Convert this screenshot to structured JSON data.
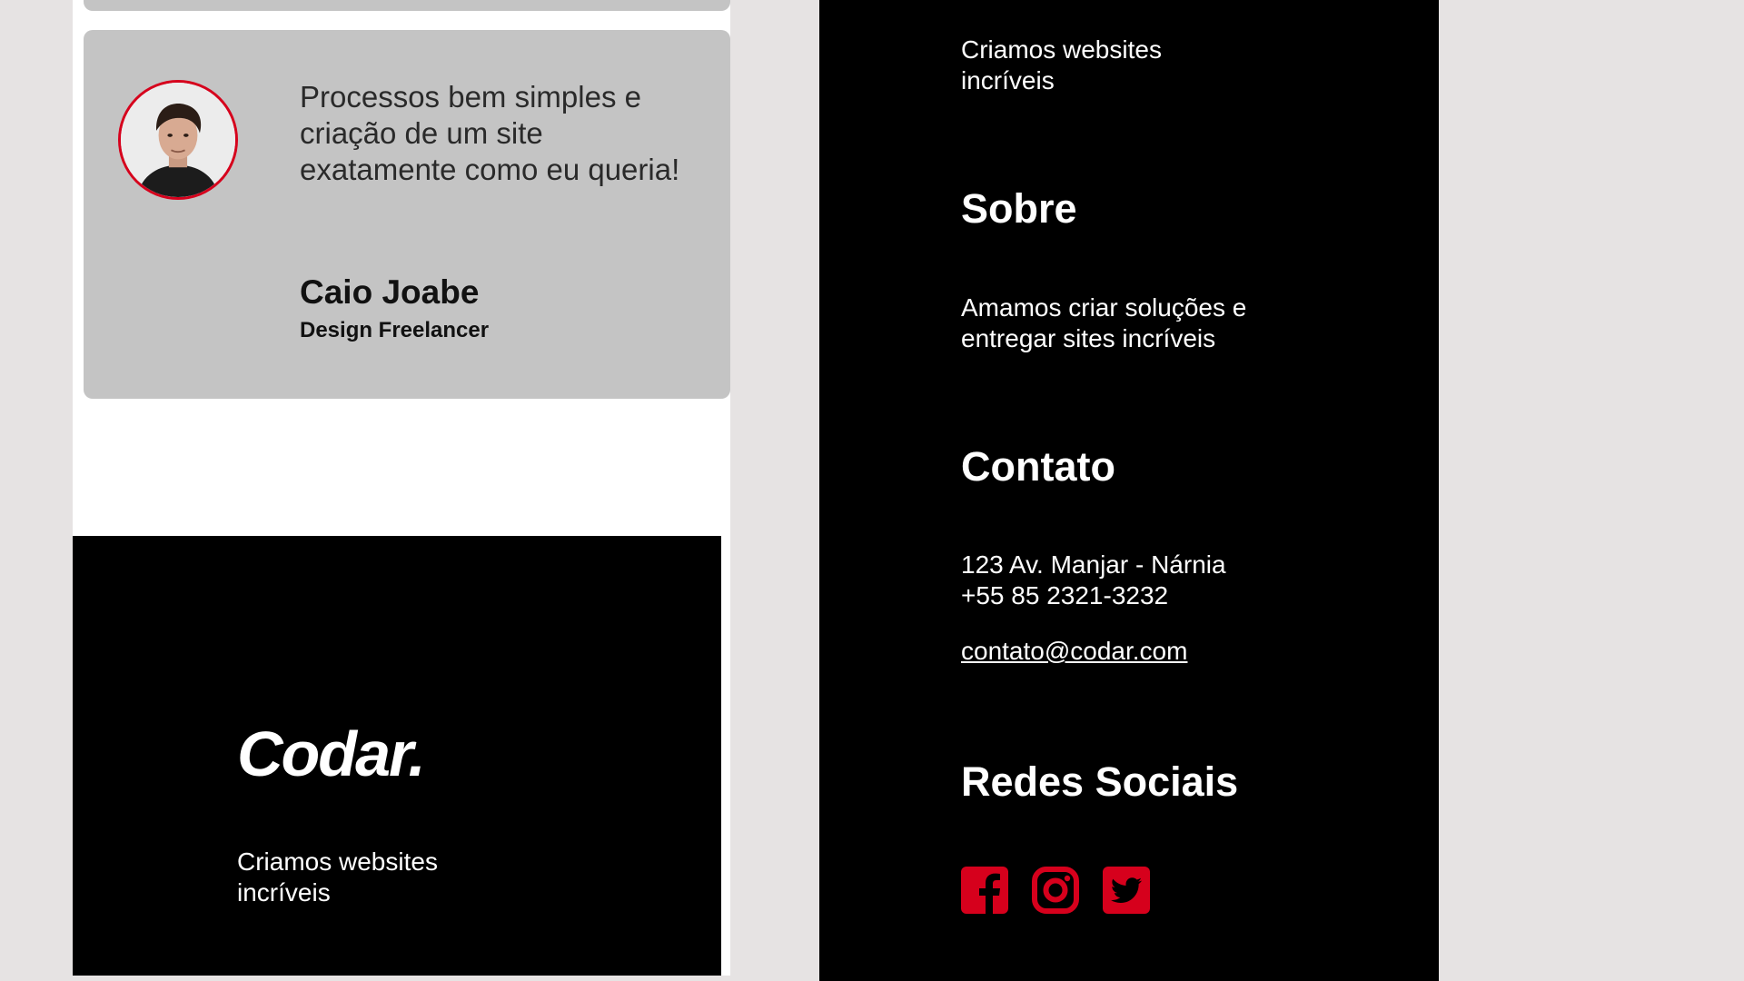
{
  "testimonial": {
    "quote": "Processos bem simples e criação de um site exatamente como eu queria!",
    "name": "Caio Joabe",
    "role": "Design Freelancer"
  },
  "left_footer": {
    "logo": "Codar.",
    "tagline": "Criamos websites incríveis"
  },
  "right_footer": {
    "tagline": "Criamos websites incríveis",
    "about_title": "Sobre",
    "about_text": "Amamos criar soluções e entregar sites incríveis",
    "contact_title": "Contato",
    "address": "123 Av. Manjar - Nárnia",
    "phone": "+55 85 2321-3232",
    "email": "contato@codar.com",
    "social_title": "Redes Sociais"
  },
  "social_icons": [
    "facebook-icon",
    "instagram-icon",
    "twitter-icon"
  ],
  "colors": {
    "accent": "#d6001c",
    "card_bg": "#c4c4c4",
    "page_bg": "#e6e3e3",
    "footer_bg": "#000000"
  }
}
